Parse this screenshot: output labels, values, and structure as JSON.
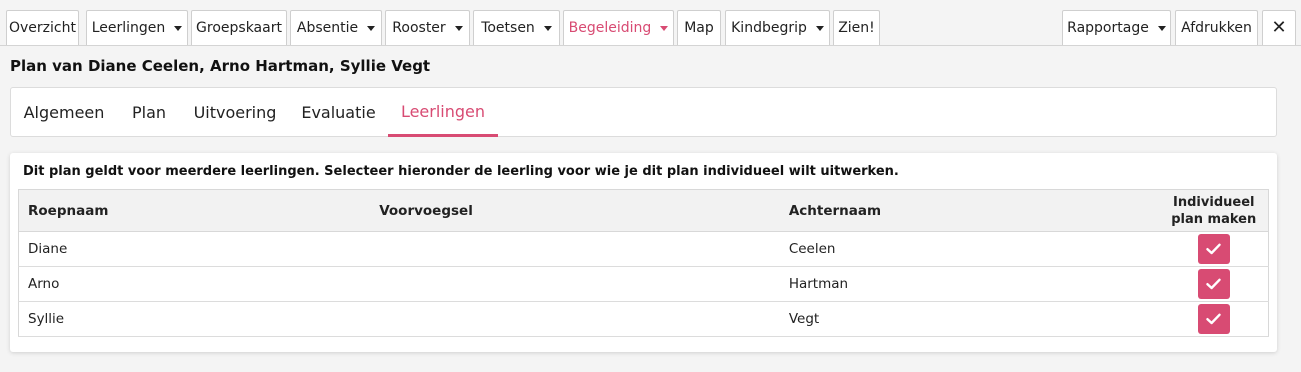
{
  "nav": {
    "items": [
      {
        "label": "Overzicht",
        "dropdown": false
      },
      {
        "label": "Leerlingen",
        "dropdown": true
      },
      {
        "label": "Groepskaart",
        "dropdown": false
      },
      {
        "label": "Absentie",
        "dropdown": true
      },
      {
        "label": "Rooster",
        "dropdown": true
      },
      {
        "label": "Toetsen",
        "dropdown": true
      },
      {
        "label": "Begeleiding",
        "dropdown": true,
        "active": true
      },
      {
        "label": "Map",
        "dropdown": false
      },
      {
        "label": "Kindbegrip",
        "dropdown": true
      },
      {
        "label": "Zien!",
        "dropdown": false
      }
    ],
    "right_items": [
      {
        "label": "Rapportage",
        "dropdown": true
      },
      {
        "label": "Afdrukken",
        "dropdown": false
      }
    ],
    "close_icon": "close-icon"
  },
  "page": {
    "title": "Plan van Diane Ceelen, Arno Hartman, Syllie Vegt"
  },
  "tabs": [
    {
      "label": "Algemeen"
    },
    {
      "label": "Plan"
    },
    {
      "label": "Uitvoering"
    },
    {
      "label": "Evaluatie"
    },
    {
      "label": "Leerlingen",
      "active": true
    }
  ],
  "card": {
    "intro": "Dit plan geldt voor meerdere leerlingen. Selecteer hieronder de leerling voor wie je dit plan individueel wilt uitwerken.",
    "columns": {
      "roepnaam": "Roepnaam",
      "voorvoegsel": "Voorvoegsel",
      "achternaam": "Achternaam",
      "individueel_line1": "Individueel",
      "individueel_line2": "plan maken"
    },
    "rows": [
      {
        "roepnaam": "Diane",
        "voorvoegsel": "",
        "achternaam": "Ceelen"
      },
      {
        "roepnaam": "Arno",
        "voorvoegsel": "",
        "achternaam": "Hartman"
      },
      {
        "roepnaam": "Syllie",
        "voorvoegsel": "",
        "achternaam": "Vegt"
      }
    ]
  },
  "colors": {
    "accent": "#d84b73",
    "background": "#f4f4f4"
  }
}
